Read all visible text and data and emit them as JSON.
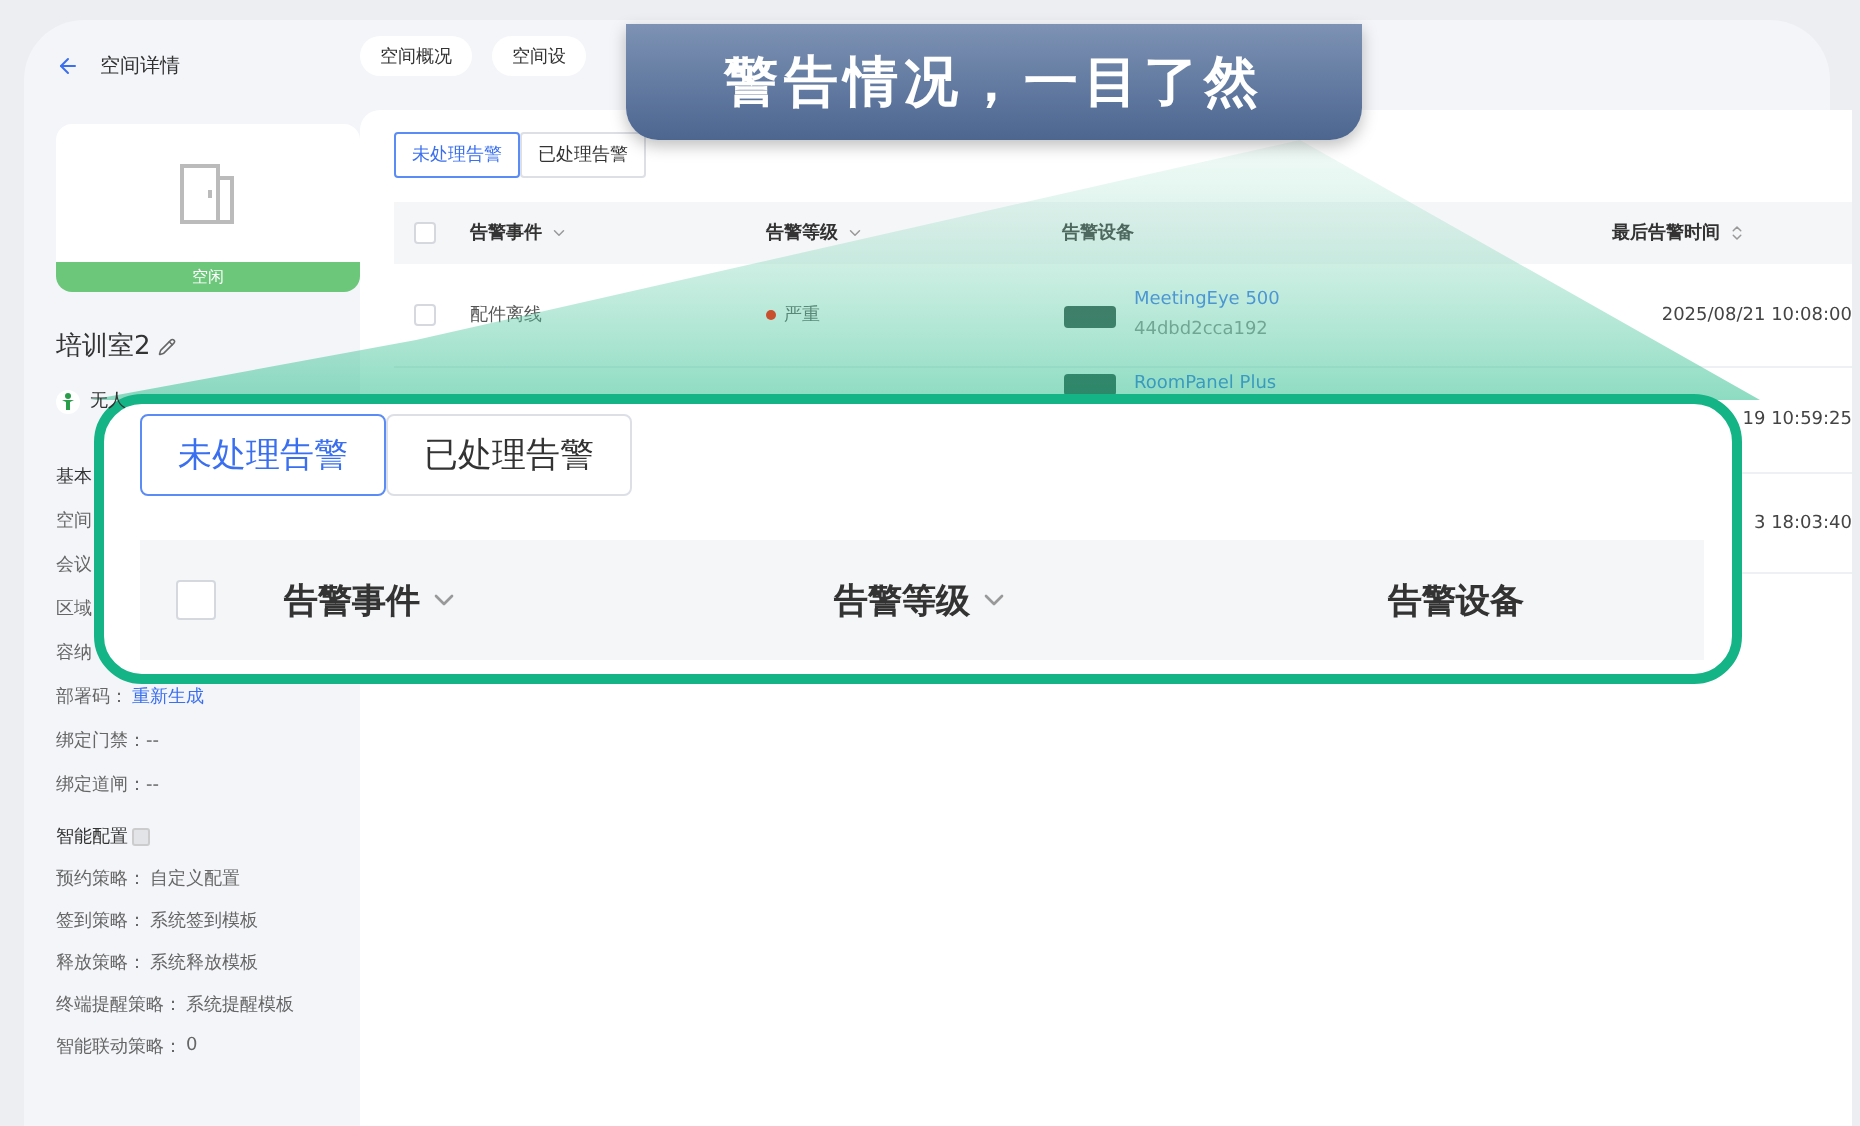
{
  "sidebar": {
    "title": "空间详情",
    "status": "空闲",
    "room_name": "培训室2",
    "occupancy": "无人",
    "section_title": "基本",
    "fields": [
      {
        "label": "空间"
      },
      {
        "label": "会议"
      },
      {
        "label": "区域"
      },
      {
        "label": "容纳"
      },
      {
        "label": "部署码：",
        "link": "重新生成"
      },
      {
        "label": "绑定门禁：--"
      },
      {
        "label": "绑定道闸：--"
      }
    ],
    "smart_title": "智能配置",
    "smart_fields": [
      {
        "label": "预约策略：",
        "value": "自定义配置"
      },
      {
        "label": "签到策略：",
        "value": "系统签到模板"
      },
      {
        "label": "释放策略：",
        "value": "系统释放模板"
      },
      {
        "label": "终端提醒策略：",
        "value": "系统提醒模板"
      },
      {
        "label": "智能联动策略：",
        "value": "0"
      }
    ]
  },
  "top_tabs": [
    {
      "label": "空间概况"
    },
    {
      "label": "空间设"
    }
  ],
  "alert_tabs": [
    {
      "label": "未处理告警",
      "selected": true
    },
    {
      "label": "已处理告警",
      "selected": false
    }
  ],
  "select_all_checked": false,
  "columns": [
    {
      "label": "告警事件",
      "kind": "filter"
    },
    {
      "label": "告警等级",
      "kind": "filter"
    },
    {
      "label": "告警设备",
      "kind": "plain"
    },
    {
      "label": "最后告警时间",
      "kind": "sort"
    }
  ],
  "rows": [
    {
      "checked": false,
      "event": "配件离线",
      "level": "严重",
      "color": "#c9502c",
      "device": "MeetingEye 500",
      "device_id": "44dbd2cca192",
      "time": "2025/08/21 10:08:00"
    },
    {
      "device": "RoomPanel Plus",
      "time": "19 10:59:25"
    },
    {
      "time": "3 18:03:40"
    }
  ],
  "callout": {
    "title": "警告情况，一目了然",
    "tabs": [
      {
        "label": "未处理告警",
        "selected": true
      },
      {
        "label": "已处理告警",
        "selected": false
      }
    ],
    "select_all_checked": false,
    "columns": [
      {
        "label": "告警事件",
        "kind": "filter"
      },
      {
        "label": "告警等级",
        "kind": "filter"
      },
      {
        "label": "告警设备",
        "kind": "plain"
      }
    ]
  }
}
